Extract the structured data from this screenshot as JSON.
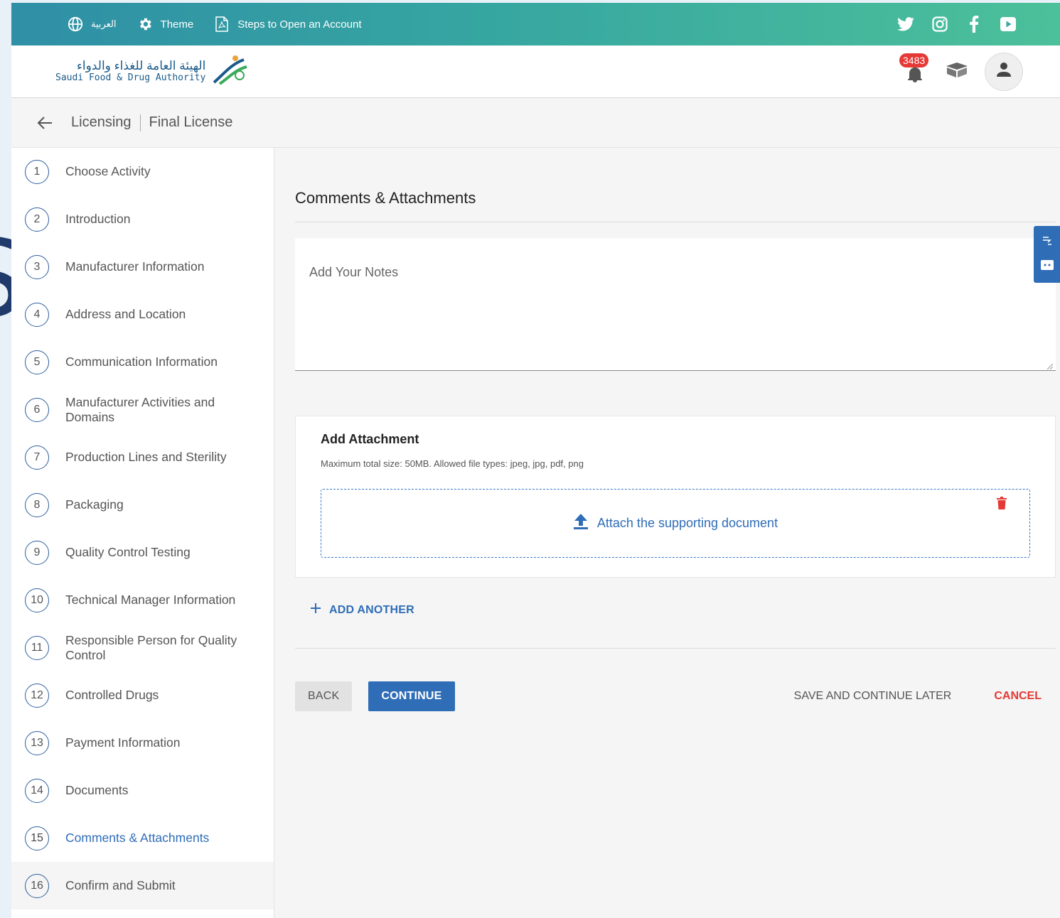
{
  "topbar": {
    "language_label": "العربية",
    "theme_label": "Theme",
    "steps_label": "Steps to Open an Account",
    "social_icons": [
      "twitter-icon",
      "instagram-icon",
      "facebook-icon",
      "youtube-icon"
    ]
  },
  "header": {
    "logo_ar": "الهيئة العامة للغذاء والدواء",
    "logo_en": "Saudi Food & Drug Authority",
    "notification_count": "3483"
  },
  "breadcrumb": {
    "parent": "Licensing",
    "current": "Final License"
  },
  "steps": [
    {
      "num": "1",
      "label": "Choose Activity"
    },
    {
      "num": "2",
      "label": "Introduction"
    },
    {
      "num": "3",
      "label": "Manufacturer Information"
    },
    {
      "num": "4",
      "label": "Address and Location"
    },
    {
      "num": "5",
      "label": "Communication Information"
    },
    {
      "num": "6",
      "label": "Manufacturer Activities and Domains"
    },
    {
      "num": "7",
      "label": "Production Lines and Sterility"
    },
    {
      "num": "8",
      "label": "Packaging"
    },
    {
      "num": "9",
      "label": "Quality Control Testing"
    },
    {
      "num": "10",
      "label": "Technical Manager Information"
    },
    {
      "num": "11",
      "label": "Responsible Person for Quality Control"
    },
    {
      "num": "12",
      "label": "Controlled Drugs"
    },
    {
      "num": "13",
      "label": "Payment Information"
    },
    {
      "num": "14",
      "label": "Documents"
    },
    {
      "num": "15",
      "label": "Comments & Attachments"
    },
    {
      "num": "16",
      "label": "Confirm and Submit"
    }
  ],
  "main": {
    "title": "Comments & Attachments",
    "notes_placeholder": "Add Your Notes",
    "attachment_title": "Add Attachment",
    "attachment_hint": "Maximum total size: 50MB. Allowed file types: jpeg, jpg, pdf, png",
    "attach_link": "Attach the supporting document",
    "add_another": "ADD ANOTHER"
  },
  "actions": {
    "back": "BACK",
    "continue": "CONTINUE",
    "save_later": "SAVE AND CONTINUE LATER",
    "cancel": "CANCEL"
  },
  "colors": {
    "accent": "#2f6db7",
    "danger": "#e53935",
    "topbar_start": "#2f8fa6",
    "topbar_end": "#4cc09a"
  }
}
